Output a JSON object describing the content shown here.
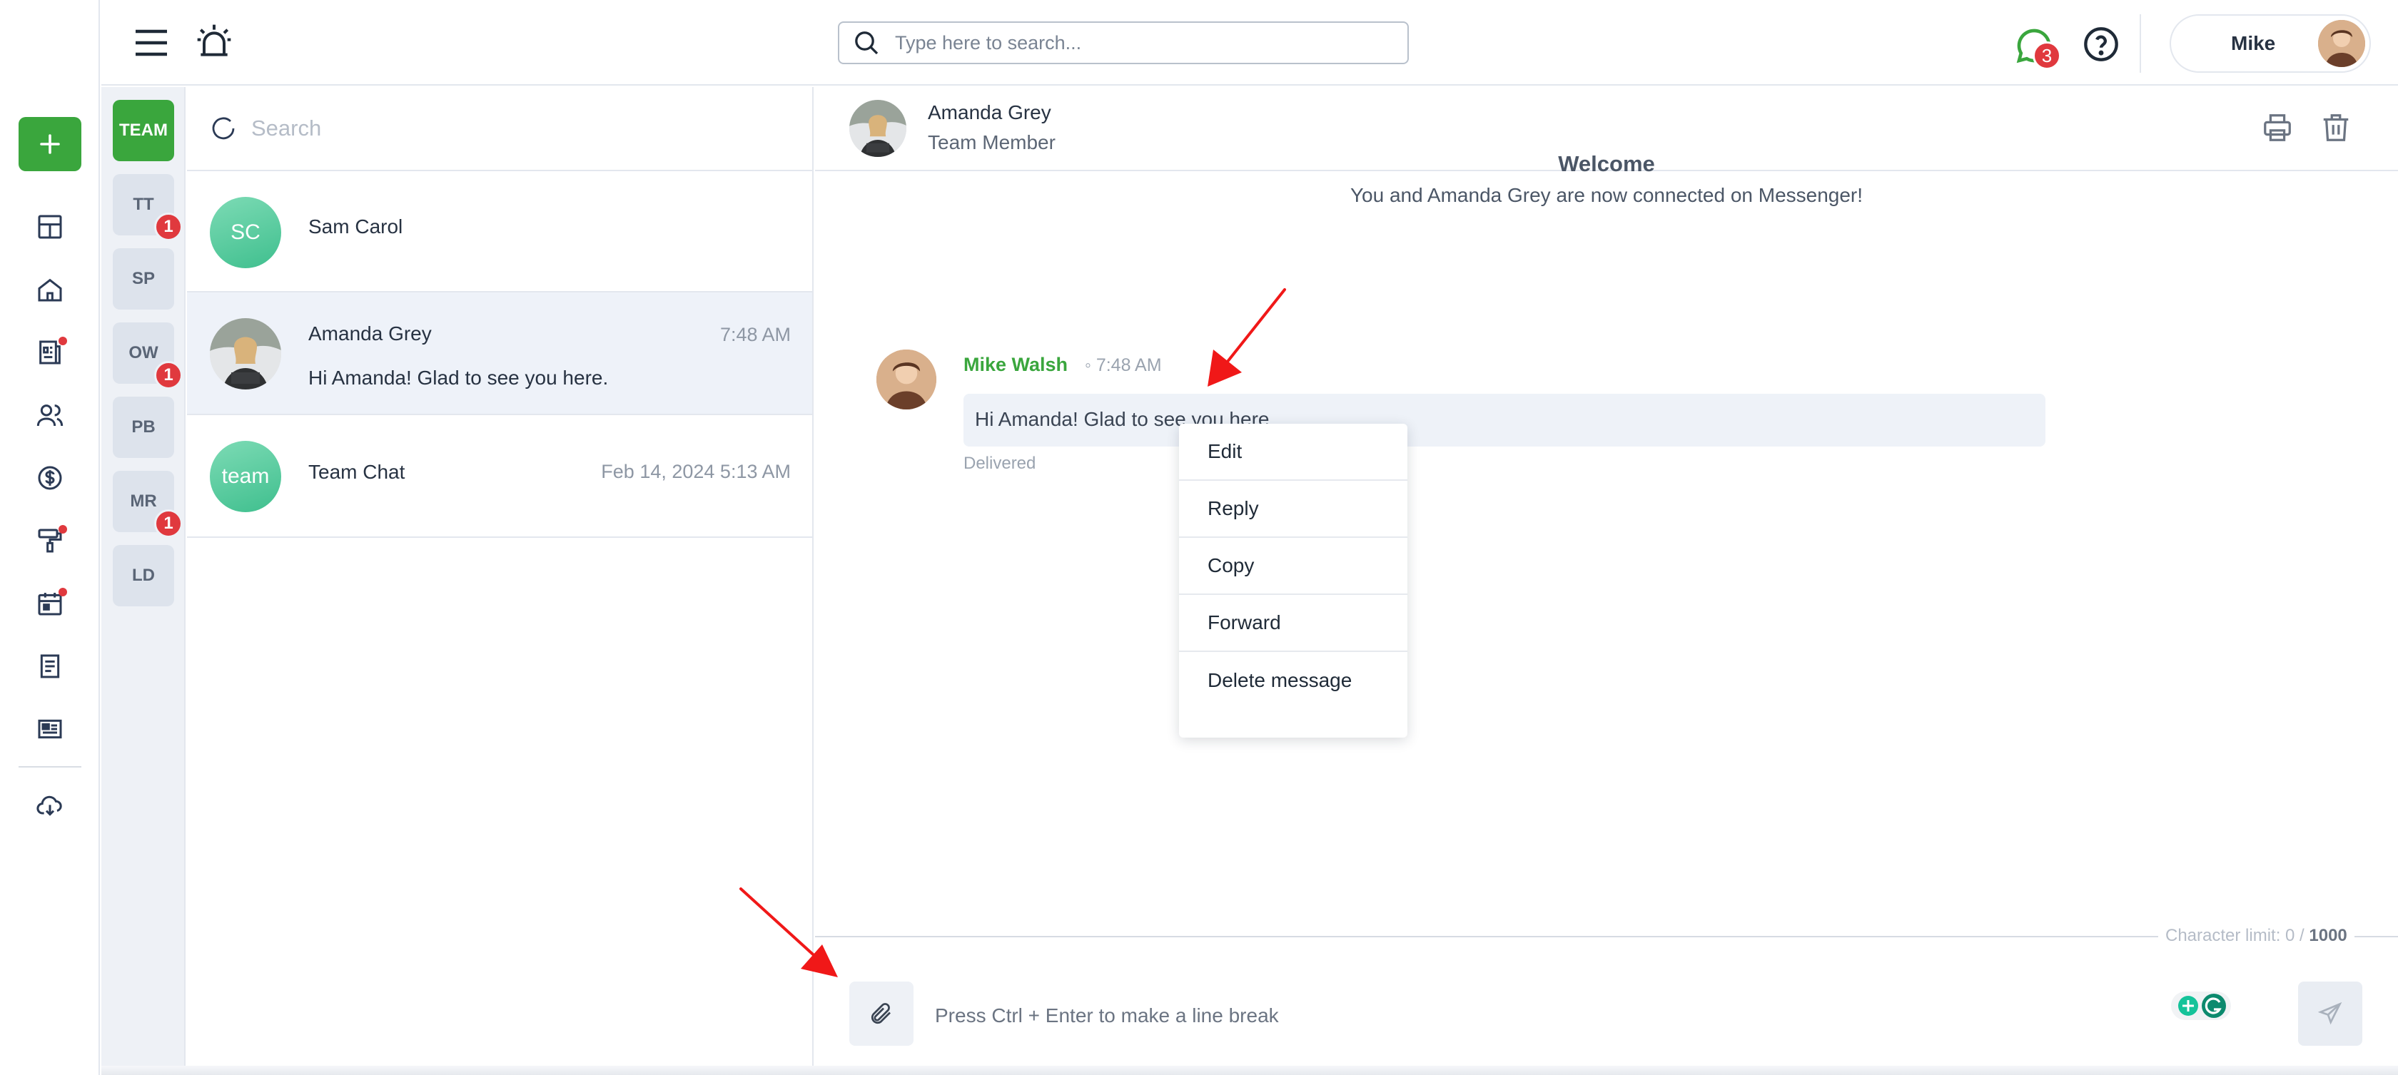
{
  "header": {
    "search_placeholder": "Type here to search...",
    "chat_badge": "3",
    "user_name": "Mike"
  },
  "rail": {
    "icons": [
      "plus-icon",
      "dashboard-icon",
      "home-icon",
      "reports-icon",
      "users-icon",
      "dollar-icon",
      "paint-roller-icon",
      "calendar-icon",
      "document-icon",
      "news-icon",
      "download-cloud-icon"
    ]
  },
  "channels": [
    {
      "label": "TEAM",
      "badge": ""
    },
    {
      "label": "TT",
      "badge": "1"
    },
    {
      "label": "SP",
      "badge": ""
    },
    {
      "label": "OW",
      "badge": "1"
    },
    {
      "label": "PB",
      "badge": ""
    },
    {
      "label": "MR",
      "badge": "1"
    },
    {
      "label": "LD",
      "badge": ""
    }
  ],
  "conversations": {
    "search_placeholder": "Search",
    "items": [
      {
        "initials": "SC",
        "name": "Sam Carol",
        "time": "",
        "preview": ""
      },
      {
        "initials": "",
        "name": "Amanda Grey",
        "time": "7:48 AM",
        "preview": "Hi Amanda! Glad to see you here."
      },
      {
        "initials": "team",
        "name": "Team Chat",
        "time": "Feb 14, 2024 5:13 AM",
        "preview": ""
      }
    ]
  },
  "chat": {
    "contact_name": "Amanda Grey",
    "contact_role": "Team Member",
    "welcome_title": "Welcome",
    "welcome_subtitle": "You and Amanda Grey are now connected on Messenger!",
    "message": {
      "author": "Mike Walsh",
      "separator": "◦",
      "time": "7:48 AM",
      "text": "Hi Amanda! Glad to see you here.",
      "status": "Delivered"
    },
    "context_menu": [
      "Edit",
      "Reply",
      "Copy",
      "Forward",
      "Delete message"
    ],
    "char_limit_label": "Character limit: 0 /",
    "char_limit_max": "1000",
    "composer_placeholder": "Press Ctrl + Enter to make a line break"
  },
  "colors": {
    "accent_green": "#3aa63d",
    "badge_red": "#e0393e",
    "annotation_arrow": "#f01818"
  }
}
